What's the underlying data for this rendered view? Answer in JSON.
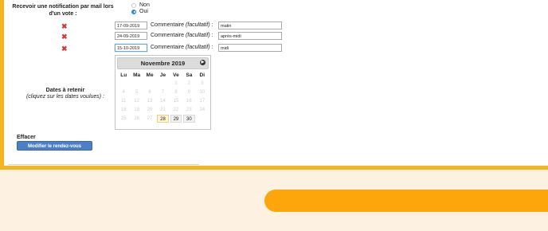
{
  "notification": {
    "label": "Recevoir une notification par mail lors d'un vote :",
    "options": [
      {
        "label": "Non",
        "checked": false
      },
      {
        "label": "Oui",
        "checked": true
      }
    ]
  },
  "dates": [
    {
      "date": "17-09-2019",
      "comment_label": "Commentaire",
      "comment_hint": "(facultatif)",
      "comment": "matin"
    },
    {
      "date": "24-09-2019",
      "comment_label": "Commentaire",
      "comment_hint": "(facultatif)",
      "comment": "après-midi"
    },
    {
      "date": "15-10-2019",
      "comment_label": "Commentaire",
      "comment_hint": "(facultatif)",
      "comment": "midi"
    }
  ],
  "dates_label": {
    "title": "Dates à retenir",
    "subtitle": "(cliquez sur les dates voulues) :"
  },
  "calendar": {
    "month": "Novembre 2019",
    "weekdays": [
      "Lu",
      "Ma",
      "Me",
      "Je",
      "Ve",
      "Sa",
      "Di"
    ],
    "weeks": [
      [
        "",
        "",
        "",
        "",
        "1",
        "2",
        "3"
      ],
      [
        "4",
        "5",
        "6",
        "7",
        "8",
        "9",
        "10"
      ],
      [
        "11",
        "12",
        "13",
        "14",
        "15",
        "16",
        "17"
      ],
      [
        "18",
        "19",
        "20",
        "21",
        "22",
        "23",
        "24"
      ],
      [
        "25",
        "26",
        "27",
        "28",
        "29",
        "30",
        ""
      ]
    ],
    "today": "28",
    "available": [
      "28",
      "29",
      "30"
    ]
  },
  "effacer_label": "Effacer",
  "submit_label": "Modifier le rendez-vous",
  "colors": {
    "accent": "#f6b51e",
    "orange": "#fca60b",
    "button": "#4b7fc6"
  }
}
